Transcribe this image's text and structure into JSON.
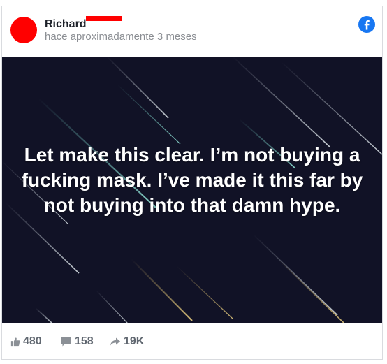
{
  "post": {
    "author_name": "Richard",
    "timestamp": "hace aproximadamente 3 meses",
    "source_icon": "facebook-icon",
    "image_text": "Let make this clear. I’m not buying a fucking mask. I’ve made it this far by not buying into that damn hype.",
    "image_background": "#111226",
    "avatar_color": "#ff0000",
    "brand_color": "#1877f2"
  },
  "stats": {
    "likes": "480",
    "comments": "158",
    "shares": "19K",
    "likes_icon": "thumbs-up-icon",
    "comments_icon": "comment-icon",
    "shares_icon": "share-arrow-icon"
  }
}
